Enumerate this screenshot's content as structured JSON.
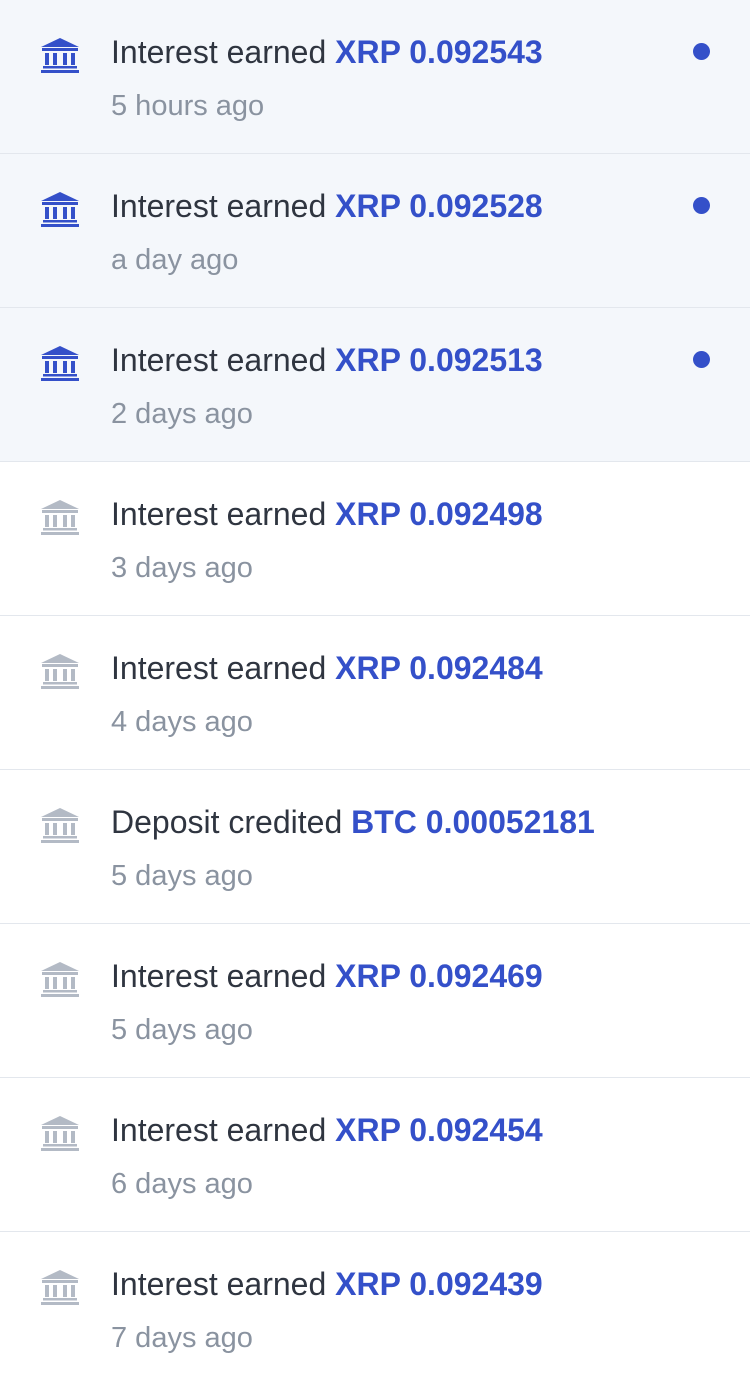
{
  "colors": {
    "accent": "#3450c9",
    "icon_unread": "#3450c9",
    "icon_read": "#b3bac5",
    "unread_background": "#f4f7fb",
    "title_text": "#2f3540",
    "time_text": "#8a93a0"
  },
  "notifications": [
    {
      "icon": "bank-icon",
      "unread": true,
      "text": "Interest earned",
      "amount": "XRP 0.092543",
      "time": "5 hours ago"
    },
    {
      "icon": "bank-icon",
      "unread": true,
      "text": "Interest earned",
      "amount": "XRP 0.092528",
      "time": "a day ago"
    },
    {
      "icon": "bank-icon",
      "unread": true,
      "text": "Interest earned",
      "amount": "XRP 0.092513",
      "time": "2 days ago"
    },
    {
      "icon": "bank-icon",
      "unread": false,
      "text": "Interest earned",
      "amount": "XRP 0.092498",
      "time": "3 days ago"
    },
    {
      "icon": "bank-icon",
      "unread": false,
      "text": "Interest earned",
      "amount": "XRP 0.092484",
      "time": "4 days ago"
    },
    {
      "icon": "bank-icon",
      "unread": false,
      "text": "Deposit credited",
      "amount": "BTC 0.00052181",
      "time": "5 days ago"
    },
    {
      "icon": "bank-icon",
      "unread": false,
      "text": "Interest earned",
      "amount": "XRP 0.092469",
      "time": "5 days ago"
    },
    {
      "icon": "bank-icon",
      "unread": false,
      "text": "Interest earned",
      "amount": "XRP 0.092454",
      "time": "6 days ago"
    },
    {
      "icon": "bank-icon",
      "unread": false,
      "text": "Interest earned",
      "amount": "XRP 0.092439",
      "time": "7 days ago"
    }
  ]
}
